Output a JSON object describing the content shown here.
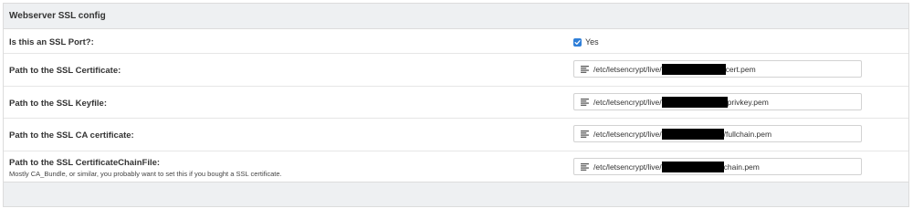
{
  "panel": {
    "title": "Webserver SSL config"
  },
  "rows": [
    {
      "label": "Is this an SSL Port?:",
      "type": "checkbox",
      "checked": true,
      "value_label": "Yes"
    },
    {
      "label": "Path to the SSL Certificate:",
      "type": "text",
      "path_prefix": "/etc/letsencrypt/live/",
      "path_suffix": "cert.pem"
    },
    {
      "label": "Path to the SSL Keyfile:",
      "type": "text",
      "path_prefix": "/etc/letsencrypt/live/",
      "path_suffix": "privkey.pem"
    },
    {
      "label": "Path to the SSL CA certificate:",
      "type": "text",
      "path_prefix": "/etc/letsencrypt/live/",
      "path_suffix": "/fullchain.pem"
    },
    {
      "label": "Path to the SSL CertificateChainFile:",
      "hint": "Mostly CA_Bundle, or similar, you probably want to set this if you bought a SSL certificate.",
      "type": "text",
      "path_prefix": "/etc/letsencrypt/live/",
      "path_suffix": "chain.pem"
    }
  ],
  "icons": {
    "checkbox": "checkmark-icon",
    "field": "text-lines-icon"
  },
  "colors": {
    "header_bg": "#eef0f2",
    "checkbox_blue": "#2f7fd8",
    "redaction": "#000000"
  }
}
